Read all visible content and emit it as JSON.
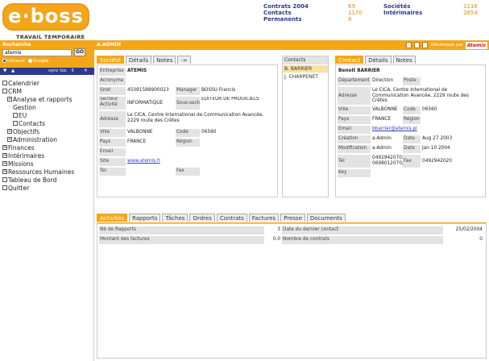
{
  "header": {
    "logo_text": "e·boss",
    "logo_subtitle": "TRAVAIL TEMPORAIRE",
    "stats_left": [
      {
        "label": "Contrats 2004",
        "value": "69"
      },
      {
        "label": "Contacts",
        "value": "1170"
      },
      {
        "label": "Permanents",
        "value": "8"
      }
    ],
    "stats_right": [
      {
        "label": "Sociétés",
        "value": "1116"
      },
      {
        "label": "Intérimaires",
        "value": "2654"
      }
    ]
  },
  "topbar": {
    "user": "A.ADMIN",
    "developed_by": "Développé par",
    "brand": "Atemis"
  },
  "sidebar": {
    "search_label": "Recherche",
    "search_value": "atemis",
    "go_label": "GO",
    "radio_intranet": "Intranet",
    "radio_google": "Google",
    "sync_label": "sync toc",
    "tree": [
      {
        "label": "Calendrier",
        "box": ""
      },
      {
        "label": "CRM",
        "box": ""
      },
      {
        "label": "Analyse et rapports",
        "box": "+"
      },
      {
        "label": "Gestion",
        "box": "-"
      },
      {
        "label": "EU",
        "box": ""
      },
      {
        "label": "Contacts",
        "box": ""
      },
      {
        "label": "Objectifs",
        "box": "+"
      },
      {
        "label": "Administration",
        "box": "+"
      },
      {
        "label": "Finances",
        "box": "+"
      },
      {
        "label": "Intérimaires",
        "box": "+"
      },
      {
        "label": "Missions",
        "box": "+"
      },
      {
        "label": "Ressources Humaines",
        "box": "+"
      },
      {
        "label": "Tableau de Bord",
        "box": ""
      },
      {
        "label": "Quitter",
        "box": ""
      }
    ]
  },
  "company": {
    "tabs": [
      "Société",
      "Détails",
      "Notes",
      "->"
    ],
    "entreprise_label": "Entreprise",
    "entreprise": "ATEMIS",
    "acronyme_label": "Acronyme",
    "acronyme": "",
    "siret_label": "Siret",
    "siret": "45091588900023",
    "manager_label": "Manager",
    "manager": "BOSSU Francis",
    "secteur_label": "Secteur Activité",
    "secteur": "INFORMATIQUE",
    "sous_secteur_label": "Sous-secteur",
    "sous_secteur": "EDITEUR DE PROGICIELS",
    "adresse_label": "Adresse",
    "adresse": "Le CICA, Centre International de Communication Avancée, 2229 route des Crêtes",
    "ville_label": "Ville",
    "ville": "VALBONNE",
    "code_label": "Code",
    "code": "06560",
    "pays_label": "Pays",
    "pays": "FRANCE",
    "region_label": "Région",
    "region": "",
    "email_label": "Email",
    "email": "",
    "site_label": "Site",
    "site": "www.atemis.fr",
    "tel_label": "Tel.",
    "tel": "",
    "fax_label": "Fax",
    "fax": ""
  },
  "contacts": {
    "header": "Contacts",
    "items": [
      "B. BARRIER",
      "J. CHARPENET"
    ]
  },
  "contact": {
    "tabs": [
      "Contact",
      "Détails",
      "Notes"
    ],
    "name": "Benoit BARRIER",
    "departement_label": "Département",
    "departement": "Direction",
    "poste_label": "Poste",
    "poste": "",
    "adresse_label": "Adresse",
    "adresse": "Le CICA, Centre International de Communication Avancée, 2229 route des Crêtes",
    "ville_label": "Ville",
    "ville": "VALBONNE",
    "code_label": "Code",
    "code": "06560",
    "pays_label": "Pays",
    "pays": "FRANCE",
    "region_label": "Région",
    "region": "",
    "email_label": "Email",
    "email": "bbarrier@atemis.pl",
    "creation_label": "Création",
    "creation": "a.Admin",
    "creation_date_label": "Date",
    "creation_date": "Aug 27 2003",
    "modification_label": "Modification",
    "modification": "a.Admin",
    "modification_date_label": "Date",
    "modification_date": "Jan 10 2004",
    "tel_label": "Tel",
    "tel": "0492942070; 0698012070;",
    "fax_label": "Fax",
    "fax": "0492942020",
    "key_label": "Key",
    "key": ""
  },
  "activity": {
    "tabs": [
      "Activités",
      "Rapports",
      "Tâches",
      "Ordres",
      "Contrats",
      "Factures",
      "Presse",
      "Documents"
    ],
    "nb_rapports_label": "Nb de Rapports",
    "nb_rapports": "3",
    "dernier_contact_label": "Date du dernier contact",
    "dernier_contact": "25/02/2004",
    "montant_label": "Montant des factures",
    "montant": "0.0",
    "nb_contrats_label": "Nombre de contrats",
    "nb_contrats": "0"
  },
  "colors": {
    "accent": "#f4a61a",
    "nav_blue": "#2d3a8c",
    "stat_orange": "#e88a0c",
    "link_blue": "#2f3ebd",
    "selected_contact": "#f8e39e"
  }
}
